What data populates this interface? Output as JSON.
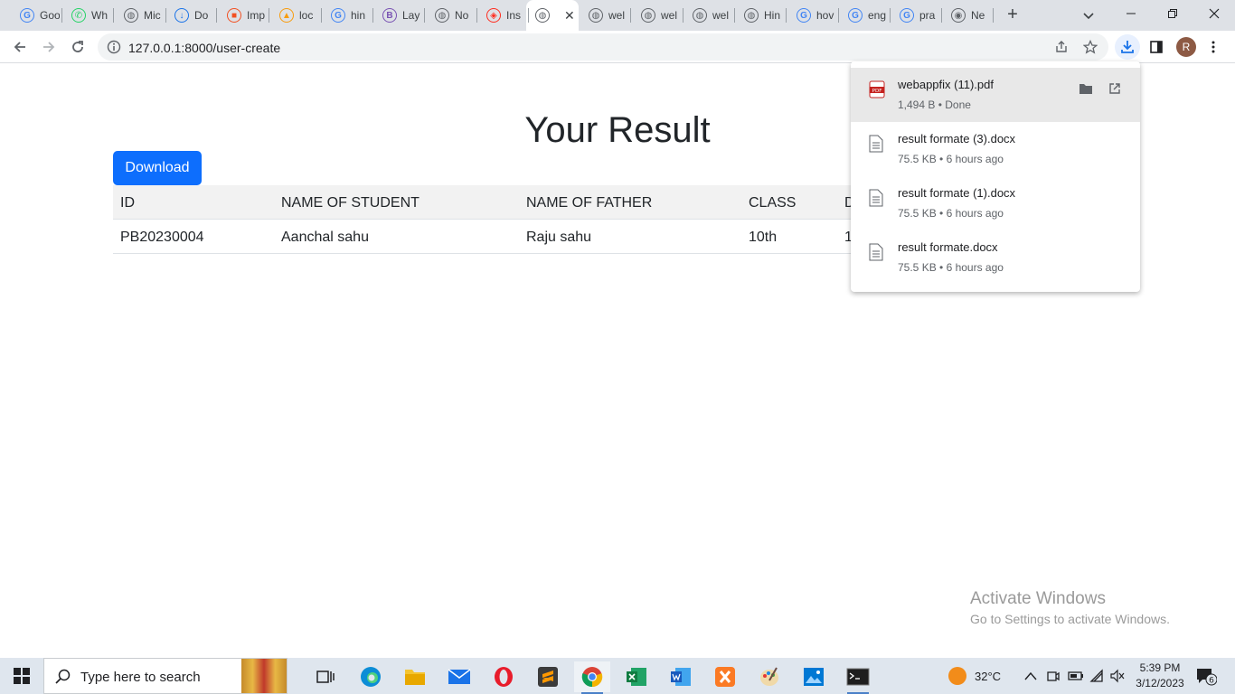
{
  "browser": {
    "tabs": [
      {
        "label": "Goo",
        "icon": "google-icon",
        "color": "#4285f4",
        "glyph": "G"
      },
      {
        "label": "Wh",
        "icon": "whatsapp-icon",
        "color": "#25d366",
        "glyph": "✆"
      },
      {
        "label": "Mic",
        "icon": "globe-icon",
        "color": "#5f6368",
        "glyph": "◍"
      },
      {
        "label": "Do",
        "icon": "download-arrow-icon",
        "color": "#1a73e8",
        "glyph": "↓"
      },
      {
        "label": "Imp",
        "icon": "microsoft-icon",
        "color": "#f25022",
        "glyph": "■"
      },
      {
        "label": "loc",
        "icon": "phpmyadmin-icon",
        "color": "#f89c0e",
        "glyph": "▲"
      },
      {
        "label": "hin",
        "icon": "google-icon",
        "color": "#4285f4",
        "glyph": "G"
      },
      {
        "label": "Lay",
        "icon": "bootstrap-icon",
        "color": "#7952b3",
        "glyph": "B"
      },
      {
        "label": "No",
        "icon": "globe-icon",
        "color": "#5f6368",
        "glyph": "◍"
      },
      {
        "label": "Ins",
        "icon": "laravel-icon",
        "color": "#ff2d20",
        "glyph": "◈"
      },
      {
        "label": "",
        "icon": "globe-icon",
        "color": "#5f6368",
        "glyph": "◍",
        "active": true
      },
      {
        "label": "wel",
        "icon": "globe-icon",
        "color": "#5f6368",
        "glyph": "◍"
      },
      {
        "label": "wel",
        "icon": "globe-icon",
        "color": "#5f6368",
        "glyph": "◍"
      },
      {
        "label": "wel",
        "icon": "globe-icon",
        "color": "#5f6368",
        "glyph": "◍"
      },
      {
        "label": "Hin",
        "icon": "globe-icon",
        "color": "#5f6368",
        "glyph": "◍"
      },
      {
        "label": "hov",
        "icon": "google-icon",
        "color": "#4285f4",
        "glyph": "G"
      },
      {
        "label": "eng",
        "icon": "google-icon",
        "color": "#4285f4",
        "glyph": "G"
      },
      {
        "label": "pra",
        "icon": "google-icon",
        "color": "#4285f4",
        "glyph": "G"
      },
      {
        "label": "Ne",
        "icon": "chrome-icon",
        "color": "#5f6368",
        "glyph": "◉"
      }
    ],
    "url": "127.0.0.1:8000/user-create",
    "profile_initial": "R"
  },
  "page": {
    "title": "Your Result",
    "download_label": "Download",
    "table": {
      "headers": [
        "ID",
        "NAME OF STUDENT",
        "NAME OF FATHER",
        "CLASS",
        "D"
      ],
      "rows": [
        [
          "PB20230004",
          "Aanchal sahu",
          "Raju sahu",
          "10th",
          "1"
        ]
      ]
    }
  },
  "downloads": [
    {
      "name": "webappfix (11).pdf",
      "meta": "1,494 B • Done",
      "type": "pdf-file-icon"
    },
    {
      "name": "result formate (3).docx",
      "meta": "75.5 KB • 6 hours ago",
      "type": "document-file-icon"
    },
    {
      "name": "result formate (1).docx",
      "meta": "75.5 KB • 6 hours ago",
      "type": "document-file-icon"
    },
    {
      "name": "result formate.docx",
      "meta": "75.5 KB • 6 hours ago",
      "type": "document-file-icon"
    }
  ],
  "watermark": {
    "line1": "Activate Windows",
    "line2": "Go to Settings to activate Windows."
  },
  "taskbar": {
    "search_placeholder": "Type here to search",
    "weather": "32°C",
    "time": "5:39 PM",
    "date": "3/12/2023",
    "notifications": "6"
  },
  "colors": {
    "primary_button": "#0d6efd",
    "tab_strip": "#dee1e6",
    "taskbar": "#dfe6ee"
  }
}
